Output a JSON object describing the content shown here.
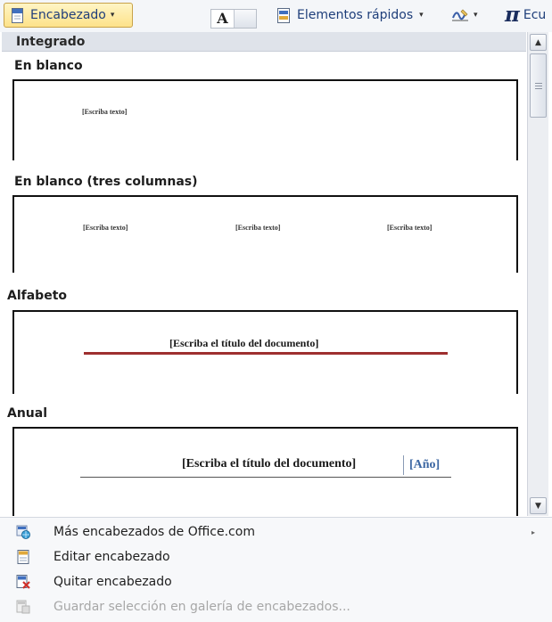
{
  "ribbon": {
    "header_button_label": "Encabezado",
    "header_button_caret": "▾",
    "textbox_letter": "A",
    "quick_parts_label": "Elementos rápidos",
    "quick_parts_caret": "▾",
    "signature_caret": "▾",
    "equation_symbol": "π",
    "equation_label": "Ecu"
  },
  "gallery": {
    "section_title": "Integrado",
    "items": [
      {
        "name": "En blanco",
        "placeholders": [
          "[Escriba texto]"
        ]
      },
      {
        "name": "En blanco (tres columnas)",
        "placeholders": [
          "[Escriba texto]",
          "[Escriba texto]",
          "[Escriba texto]"
        ]
      },
      {
        "name": "Alfabeto",
        "title_placeholder": "[Escriba el título del documento]"
      },
      {
        "name": "Anual",
        "title_placeholder": "[Escriba el título del documento]",
        "year_placeholder": "[Año]"
      }
    ]
  },
  "scrollbar": {
    "up_arrow": "▲",
    "down_arrow": "▼"
  },
  "menu": {
    "items": [
      {
        "label": "Más encabezados de Office.com",
        "submenu_arrow": "▸",
        "enabled": true
      },
      {
        "label": "Editar encabezado",
        "enabled": true
      },
      {
        "label": "Quitar encabezado",
        "enabled": true
      },
      {
        "label": "Guardar selección en galería de encabezados...",
        "enabled": false
      }
    ]
  },
  "colors": {
    "accent_button_top": "#fff5c5",
    "accent_button_bottom": "#fde28a",
    "alfabeto_rule": "#9e2f2f",
    "anual_year": "#3c67a3",
    "disabled_text": "#a7a7a7"
  }
}
